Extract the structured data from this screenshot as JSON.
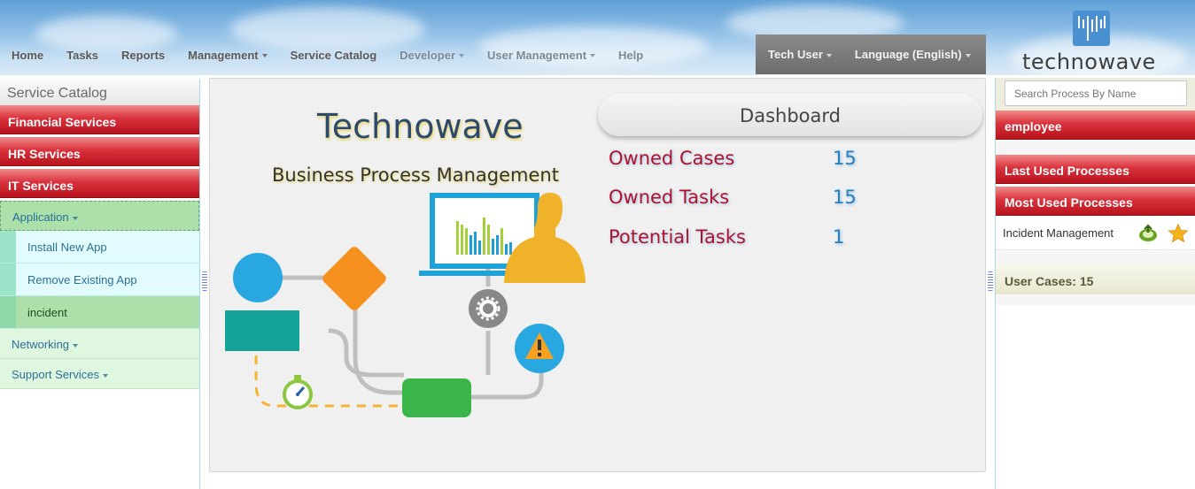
{
  "nav": {
    "items": [
      {
        "label": "Home",
        "dropdown": false
      },
      {
        "label": "Tasks",
        "dropdown": false
      },
      {
        "label": "Reports",
        "dropdown": false
      },
      {
        "label": "Management",
        "dropdown": true
      },
      {
        "label": "Service Catalog",
        "dropdown": false
      },
      {
        "label": "Developer",
        "dropdown": true
      },
      {
        "label": "User Management",
        "dropdown": true
      },
      {
        "label": "Help",
        "dropdown": false
      }
    ],
    "user_label": "Tech User",
    "language_label": "Language (English)",
    "logo_text": "technowave"
  },
  "sidebar": {
    "title": "Service Catalog",
    "categories": [
      "Financial Services",
      "HR Services",
      "IT Services"
    ],
    "application_label": "Application",
    "application_items": [
      "Install New App",
      "Remove Existing App",
      "incident"
    ],
    "networking_label": "Networking",
    "support_label": "Support Services"
  },
  "main": {
    "brand": "Technowave",
    "subtitle": "Business Process Management",
    "dashboard_title": "Dashboard",
    "stats": [
      {
        "label": "Owned Cases",
        "value": "15"
      },
      {
        "label": "Owned Tasks",
        "value": "15"
      },
      {
        "label": "Potential Tasks",
        "value": "1"
      }
    ]
  },
  "right_panel": {
    "search_placeholder": "Search Process By Name",
    "employee_label": "employee",
    "last_used_label": "Last Used Processes",
    "most_used_label": "Most Used Processes",
    "most_used_items": [
      {
        "label": "Incident Management"
      }
    ],
    "user_cases_label": "User Cases: 15"
  },
  "colors": {
    "accent_red": "#c0141e",
    "link_blue": "#2a6f96",
    "stat_red": "#b0132a",
    "stat_blue": "#2a7fb8",
    "brand_blue": "#4a8fcf"
  }
}
